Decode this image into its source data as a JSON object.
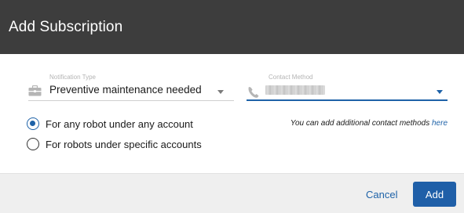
{
  "dialog": {
    "title": "Add Subscription"
  },
  "notification_type": {
    "label": "Notification Type",
    "value": "Preventive maintenance needed",
    "icon": "briefcase-icon"
  },
  "contact_method": {
    "label": "Contact Method",
    "value_redacted": true,
    "icon": "phone-icon"
  },
  "scope": {
    "options": [
      {
        "label": "For any robot under any account",
        "checked": true
      },
      {
        "label": "For robots under specific accounts",
        "checked": false
      }
    ]
  },
  "hint": {
    "text": "You can add additional contact methods ",
    "link": "here"
  },
  "footer": {
    "cancel_label": "Cancel",
    "add_label": "Add"
  },
  "colors": {
    "header_bg": "#3d3d3d",
    "accent": "#1e62a8",
    "footer_bg": "#efefef"
  }
}
